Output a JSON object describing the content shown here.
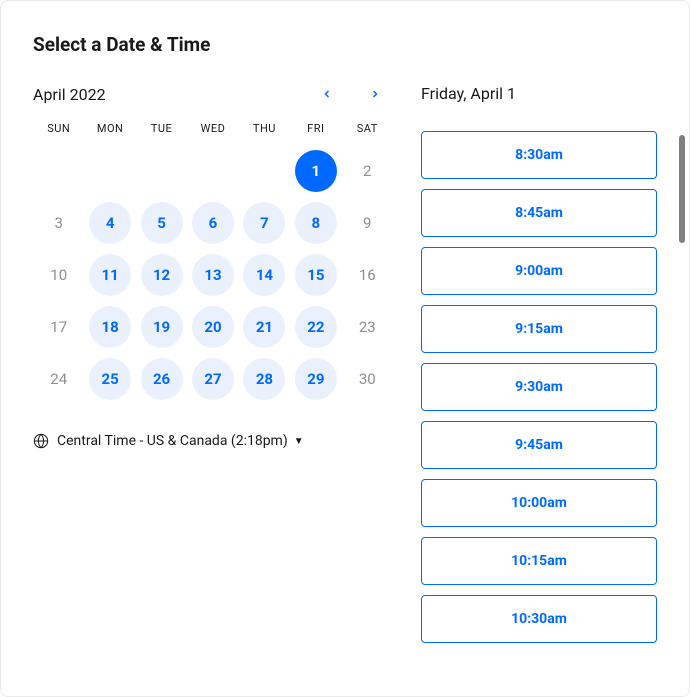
{
  "title": "Select a Date & Time",
  "calendar": {
    "month_label": "April 2022",
    "weekdays": [
      "SUN",
      "MON",
      "TUE",
      "WED",
      "THU",
      "FRI",
      "SAT"
    ],
    "days": [
      {
        "n": "",
        "state": "blank"
      },
      {
        "n": "",
        "state": "blank"
      },
      {
        "n": "",
        "state": "blank"
      },
      {
        "n": "",
        "state": "blank"
      },
      {
        "n": "",
        "state": "blank"
      },
      {
        "n": "1",
        "state": "selected"
      },
      {
        "n": "2",
        "state": "disabled"
      },
      {
        "n": "3",
        "state": "disabled"
      },
      {
        "n": "4",
        "state": "available"
      },
      {
        "n": "5",
        "state": "available"
      },
      {
        "n": "6",
        "state": "available"
      },
      {
        "n": "7",
        "state": "available"
      },
      {
        "n": "8",
        "state": "available"
      },
      {
        "n": "9",
        "state": "disabled"
      },
      {
        "n": "10",
        "state": "disabled"
      },
      {
        "n": "11",
        "state": "available"
      },
      {
        "n": "12",
        "state": "available"
      },
      {
        "n": "13",
        "state": "available"
      },
      {
        "n": "14",
        "state": "available"
      },
      {
        "n": "15",
        "state": "available"
      },
      {
        "n": "16",
        "state": "disabled"
      },
      {
        "n": "17",
        "state": "disabled"
      },
      {
        "n": "18",
        "state": "available"
      },
      {
        "n": "19",
        "state": "available"
      },
      {
        "n": "20",
        "state": "available"
      },
      {
        "n": "21",
        "state": "available"
      },
      {
        "n": "22",
        "state": "available"
      },
      {
        "n": "23",
        "state": "disabled"
      },
      {
        "n": "24",
        "state": "disabled"
      },
      {
        "n": "25",
        "state": "available"
      },
      {
        "n": "26",
        "state": "available"
      },
      {
        "n": "27",
        "state": "available"
      },
      {
        "n": "28",
        "state": "available"
      },
      {
        "n": "29",
        "state": "available"
      },
      {
        "n": "30",
        "state": "disabled"
      }
    ]
  },
  "timezone": {
    "label": "Central Time - US & Canada (2:18pm)"
  },
  "selected_date_label": "Friday, April 1",
  "time_slots": [
    "8:30am",
    "8:45am",
    "9:00am",
    "9:15am",
    "9:30am",
    "9:45am",
    "10:00am",
    "10:15am",
    "10:30am"
  ],
  "colors": {
    "accent": "#0069ff",
    "light_accent": "#eaf1fd"
  }
}
